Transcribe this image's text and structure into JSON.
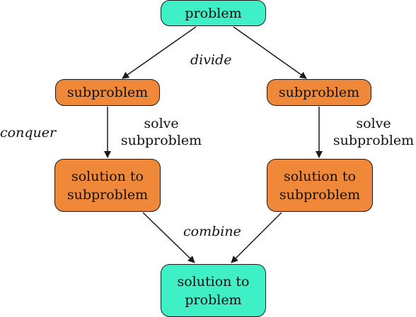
{
  "nodes": {
    "problem": "problem",
    "subproblem_left": "subproblem",
    "subproblem_right": "subproblem",
    "solution_left": "solution to\nsubproblem",
    "solution_right": "solution to\nsubproblem",
    "solution_problem": "solution to\nproblem"
  },
  "labels": {
    "divide": "divide",
    "conquer": "conquer",
    "solve_left": "solve\nsubproblem",
    "solve_right": "solve\nsubproblem",
    "combine": "combine"
  },
  "colors": {
    "teal": "#3ff0c6",
    "orange": "#f0883a"
  }
}
